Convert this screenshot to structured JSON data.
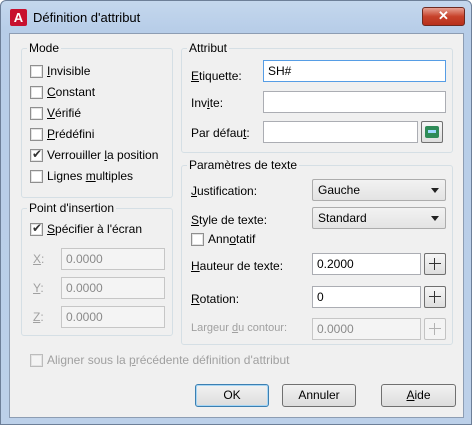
{
  "window": {
    "title": "Définition d'attribut",
    "app_icon": "A",
    "close_glyph": "✕"
  },
  "mode": {
    "title": "Mode",
    "items": [
      {
        "label": "Invisible",
        "checked": false
      },
      {
        "label": "Constant",
        "checked": false
      },
      {
        "label": "Vérifié",
        "checked": false
      },
      {
        "label": "Prédéfini",
        "checked": false
      },
      {
        "label": "Verrouiller la position",
        "checked": true
      },
      {
        "label": "Lignes multiples",
        "checked": false
      }
    ]
  },
  "insertion": {
    "title": "Point d'insertion",
    "specify_label": "Spécifier à l'écran",
    "specify_checked": true,
    "x_label": "X:",
    "x_value": "0.0000",
    "y_label": "Y:",
    "y_value": "0.0000",
    "z_label": "Z:",
    "z_value": "0.0000"
  },
  "attribute": {
    "title": "Attribut",
    "tag_label": "Etiquette:",
    "tag_value": "SH#",
    "prompt_label": "Invite:",
    "prompt_value": "",
    "default_label": "Par défaut:",
    "default_value": ""
  },
  "text_settings": {
    "title": "Paramètres de texte",
    "justification_label": "Justification:",
    "justification_value": "Gauche",
    "style_label": "Style de texte:",
    "style_value": "Standard",
    "annotative_label": "Annotatif",
    "annotative_checked": false,
    "height_label": "Hauteur de texte:",
    "height_value": "0.2000",
    "rotation_label": "Rotation:",
    "rotation_value": "0",
    "width_label": "Largeur du contour:",
    "width_value": "0.0000"
  },
  "align_label": "Aligner sous la précédente définition d'attribut",
  "buttons": {
    "ok": "OK",
    "cancel": "Annuler",
    "help": "Aide"
  }
}
